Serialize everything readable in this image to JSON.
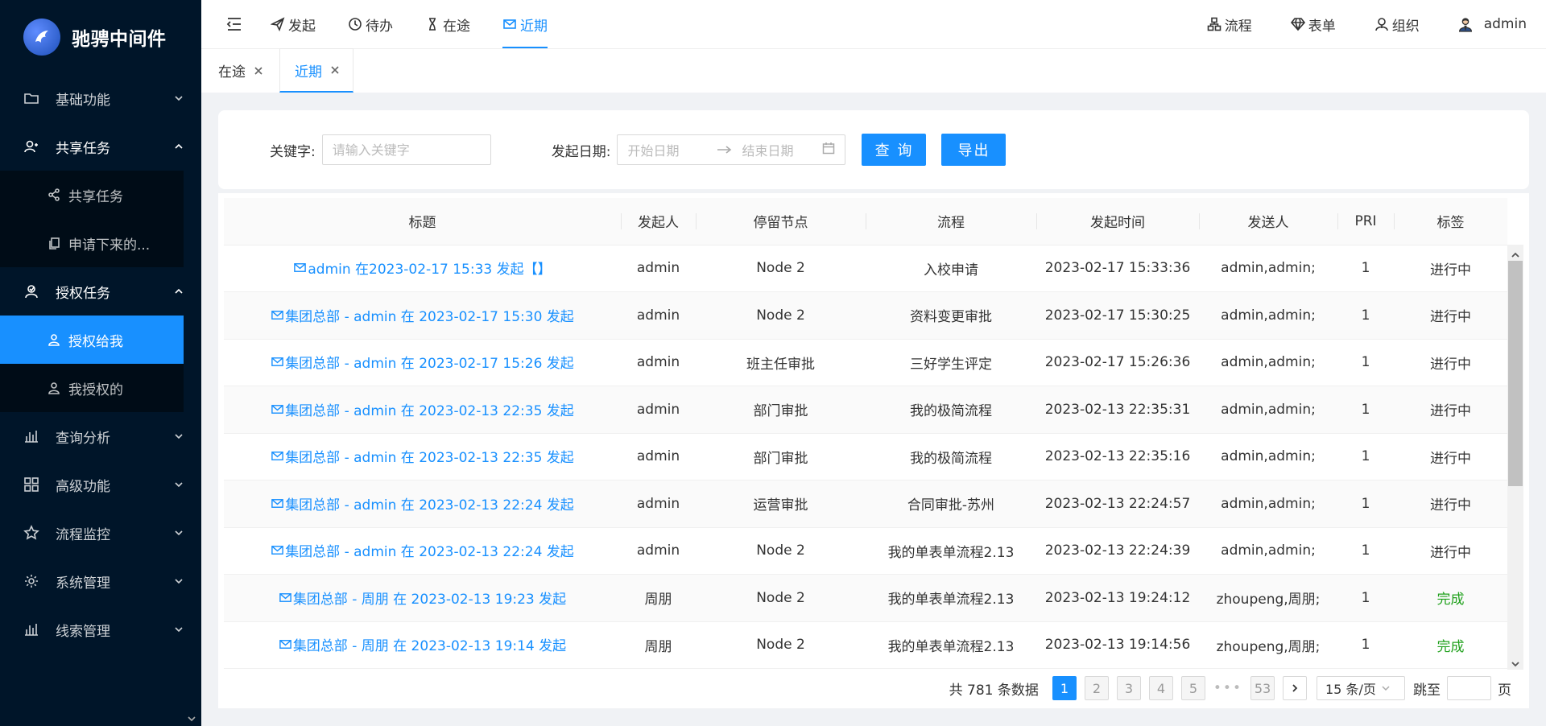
{
  "app": {
    "title": "驰骋中间件"
  },
  "sidebar": {
    "menu": [
      {
        "label": "基础功能",
        "icon": "folder-icon",
        "open": false
      },
      {
        "label": "共享任务",
        "icon": "user-share-icon",
        "open": true,
        "children": [
          {
            "label": "共享任务",
            "icon": "share-icon"
          },
          {
            "label": "申请下来的...",
            "icon": "copy-icon"
          }
        ]
      },
      {
        "label": "授权任务",
        "icon": "authorize-icon",
        "open": true,
        "children": [
          {
            "label": "授权给我",
            "icon": "user-icon",
            "active": true
          },
          {
            "label": "我授权的",
            "icon": "user-icon"
          }
        ]
      },
      {
        "label": "查询分析",
        "icon": "bar-chart-icon",
        "open": false
      },
      {
        "label": "高级功能",
        "icon": "grid-icon",
        "open": false
      },
      {
        "label": "流程监控",
        "icon": "star-icon",
        "open": false
      },
      {
        "label": "系统管理",
        "icon": "gear-icon",
        "open": false
      },
      {
        "label": "线索管理",
        "icon": "bar-chart-icon",
        "open": false
      }
    ]
  },
  "header": {
    "nav": [
      {
        "label": "发起",
        "icon": "send-icon"
      },
      {
        "label": "待办",
        "icon": "clock-icon"
      },
      {
        "label": "在途",
        "icon": "hourglass-icon"
      },
      {
        "label": "近期",
        "icon": "mail-icon",
        "active": true
      }
    ],
    "right": [
      {
        "label": "流程",
        "icon": "flow-icon"
      },
      {
        "label": "表单",
        "icon": "diamond-icon"
      },
      {
        "label": "组织",
        "icon": "org-icon"
      }
    ],
    "user": "admin"
  },
  "tabs": [
    {
      "label": "在途",
      "active": false
    },
    {
      "label": "近期",
      "active": true
    }
  ],
  "filter": {
    "keyword_label": "关键字:",
    "keyword_placeholder": "请输入关键字",
    "date_label": "发起日期:",
    "start_placeholder": "开始日期",
    "end_placeholder": "结束日期",
    "query_button": "查 询",
    "export_button": "导出"
  },
  "table": {
    "columns": [
      "标题",
      "发起人",
      "停留节点",
      "流程",
      "发起时间",
      "发送人",
      "PRI",
      "标签"
    ],
    "rows": [
      {
        "title": "admin 在2023-02-17 15:33 发起【】",
        "starter": "admin",
        "node": "Node 2",
        "flow": "入校申请",
        "time": "2023-02-17 15:33:36",
        "sender": "admin,admin;",
        "pri": "1",
        "tag": "进行中",
        "done": false
      },
      {
        "title": "集团总部 - admin 在 2023-02-17 15:30 发起",
        "starter": "admin",
        "node": "Node 2",
        "flow": "资料变更审批",
        "time": "2023-02-17 15:30:25",
        "sender": "admin,admin;",
        "pri": "1",
        "tag": "进行中",
        "done": false
      },
      {
        "title": "集团总部 - admin 在 2023-02-17 15:26 发起",
        "starter": "admin",
        "node": "班主任审批",
        "flow": "三好学生评定",
        "time": "2023-02-17 15:26:36",
        "sender": "admin,admin;",
        "pri": "1",
        "tag": "进行中",
        "done": false
      },
      {
        "title": "集团总部 - admin 在 2023-02-13 22:35 发起",
        "starter": "admin",
        "node": "部门审批",
        "flow": "我的极简流程",
        "time": "2023-02-13 22:35:31",
        "sender": "admin,admin;",
        "pri": "1",
        "tag": "进行中",
        "done": false
      },
      {
        "title": "集团总部 - admin 在 2023-02-13 22:35 发起",
        "starter": "admin",
        "node": "部门审批",
        "flow": "我的极简流程",
        "time": "2023-02-13 22:35:16",
        "sender": "admin,admin;",
        "pri": "1",
        "tag": "进行中",
        "done": false
      },
      {
        "title": "集团总部 - admin 在 2023-02-13 22:24 发起",
        "starter": "admin",
        "node": "运营审批",
        "flow": "合同审批-苏州",
        "time": "2023-02-13 22:24:57",
        "sender": "admin,admin;",
        "pri": "1",
        "tag": "进行中",
        "done": false
      },
      {
        "title": "集团总部 - admin 在 2023-02-13 22:24 发起",
        "starter": "admin",
        "node": "Node 2",
        "flow": "我的单表单流程2.13",
        "time": "2023-02-13 22:24:39",
        "sender": "admin,admin;",
        "pri": "1",
        "tag": "进行中",
        "done": false
      },
      {
        "title": "集团总部 - 周朋 在 2023-02-13 19:23 发起",
        "starter": "周朋",
        "node": "Node 2",
        "flow": "我的单表单流程2.13",
        "time": "2023-02-13 19:24:12",
        "sender": "zhoupeng,周朋;",
        "pri": "1",
        "tag": "完成",
        "done": true
      },
      {
        "title": "集团总部 - 周朋 在 2023-02-13 19:14 发起",
        "starter": "周朋",
        "node": "Node 2",
        "flow": "我的单表单流程2.13",
        "time": "2023-02-13 19:14:56",
        "sender": "zhoupeng,周朋;",
        "pri": "1",
        "tag": "完成",
        "done": true
      }
    ]
  },
  "pagination": {
    "total_text": "共 781 条数据",
    "pages": [
      "1",
      "2",
      "3",
      "4",
      "5"
    ],
    "current": "1",
    "dots": "•••",
    "last": "53",
    "page_size": "15 条/页",
    "jump_label": "跳至",
    "page_suffix": "页"
  },
  "colors": {
    "primary": "#1890ff",
    "sidebar_bg": "#001529",
    "done": "#21a11d"
  }
}
